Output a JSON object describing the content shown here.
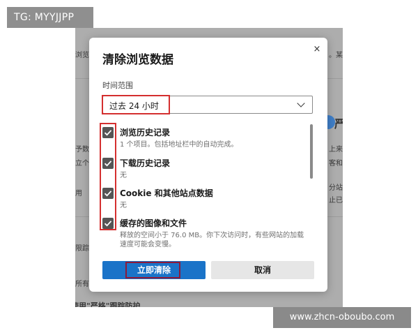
{
  "watermarks": {
    "top": "TG: MYYJJPP",
    "bottom": "www.zhcn-oboubo.com"
  },
  "background": {
    "fragments": [
      "浏览",
      "。某",
      "予数据",
      "上来",
      "立个性",
      "客和",
      "用",
      "分站",
      "止已",
      "限踪",
      "所有",
      "使用\"严格\"跟踪防护",
      "严"
    ],
    "toggle_color": "#3f7ec7"
  },
  "dialog": {
    "title": "清除浏览数据",
    "close_icon": "×",
    "time_range_label": "时间范围",
    "time_range_value": "过去 24 小时",
    "items": [
      {
        "label": "浏览历史记录",
        "description": "1 个项目。包括地址栏中的自动完成。",
        "checked": true
      },
      {
        "label": "下载历史记录",
        "description": "无",
        "checked": true
      },
      {
        "label": "Cookie 和其他站点数据",
        "description": "无",
        "checked": true
      },
      {
        "label": "缓存的图像和文件",
        "description": "释放的空间小于 76.0 MB。你下次访问时，有些网站的加载",
        "description_line2": "速度可能会变慢。",
        "checked": true
      }
    ],
    "primary_button": "立即清除",
    "secondary_button": "取消"
  },
  "colors": {
    "accent": "#1a73c8",
    "highlight_box": "#d42f2f",
    "overlay": "#adadad"
  }
}
